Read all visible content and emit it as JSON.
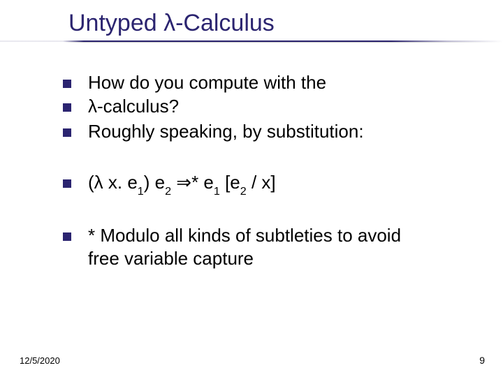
{
  "title": "Untyped λ-Calculus",
  "bullets": {
    "b1_line1": "How do you compute with the",
    "b1_line2": "λ-calculus?",
    "b2": "Roughly speaking, by substitution:",
    "b3_prefix": "(λ x. e",
    "b3_sub1": "1",
    "b3_mid1": ") e",
    "b3_sub2": "2",
    "b3_arrow": " ⇒* e",
    "b3_sub3": "1",
    "b3_mid2": " [e",
    "b3_sub4": "2",
    "b3_end": " / x]",
    "b4_line1": "* Modulo all kinds of subtleties to avoid",
    "b4_line2": "free variable capture"
  },
  "footer": {
    "date": "12/5/2020",
    "page": "9"
  }
}
